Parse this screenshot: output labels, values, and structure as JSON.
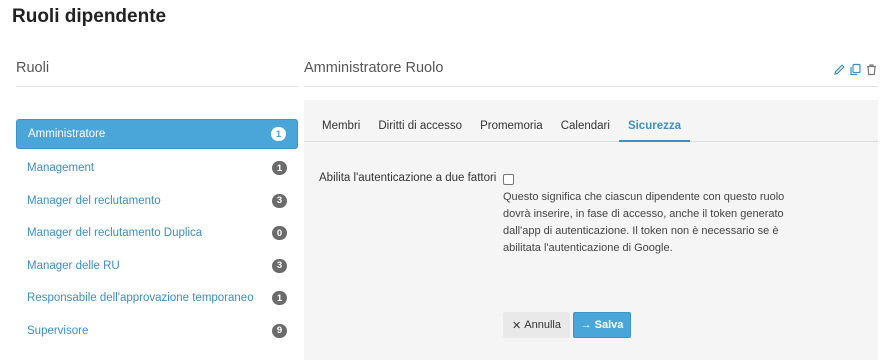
{
  "page": {
    "title": "Ruoli dipendente"
  },
  "left": {
    "heading": "Ruoli",
    "roles": [
      {
        "label": "Amministratore",
        "count": "1",
        "active": true
      },
      {
        "label": "Management",
        "count": "1"
      },
      {
        "label": "Manager del reclutamento",
        "count": "3"
      },
      {
        "label": "Manager del reclutamento Duplica",
        "count": "0"
      },
      {
        "label": "Manager delle RU",
        "count": "3"
      },
      {
        "label": "Responsabile dell'approvazione temporaneo",
        "count": "1"
      },
      {
        "label": "Supervisore",
        "count": "9"
      }
    ]
  },
  "right": {
    "heading": "Amministratore Ruolo",
    "icons": [
      "pencil-icon",
      "copy-icon",
      "trash-icon"
    ],
    "tabs": [
      "Membri",
      "Diritti di accesso",
      "Promemoria",
      "Calendari",
      "Sicurezza"
    ],
    "active_tab": "Sicurezza",
    "form": {
      "label": "Abilita l'autenticazione a due fattori",
      "checked": false,
      "help": "Questo significa che ciascun dipendente con questo ruolo dovrà inserire, in fase di accesso, anche il token generato dall'app di autenticazione. Il token non è necessario se è abilitata l'autenti­cazione di Google."
    },
    "buttons": {
      "cancel": "Annulla",
      "save": "Salva"
    }
  },
  "colors": {
    "accent": "#4aa6d8",
    "link": "#3a8fc7",
    "badge": "#6b6b6b"
  }
}
